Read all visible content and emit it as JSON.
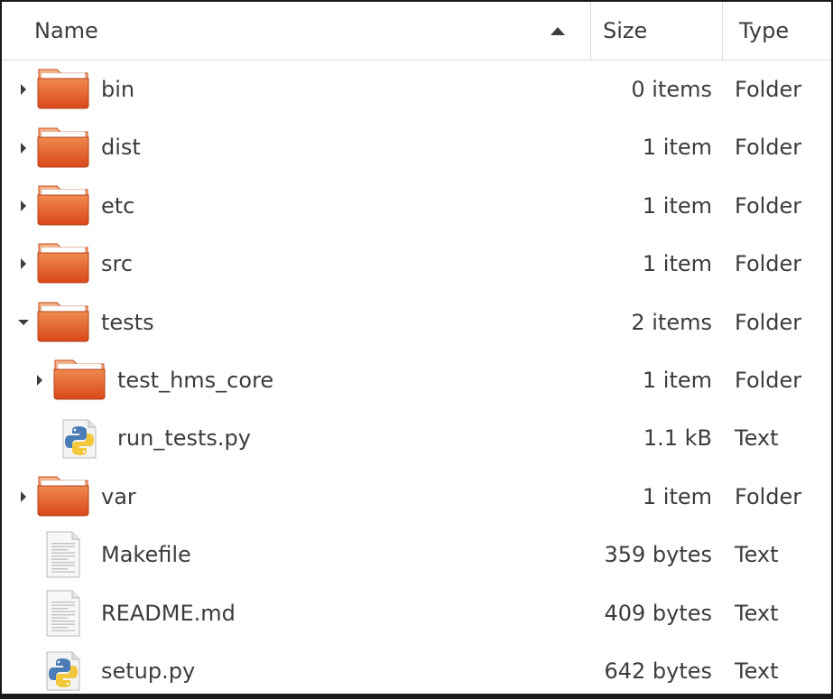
{
  "columns": {
    "name": "Name",
    "size": "Size",
    "type": "Type"
  },
  "colors": {
    "folder_top": "#f7a26f",
    "folder_body": "#e05520",
    "text": "#3c3c3c"
  },
  "rows": [
    {
      "name": "bin",
      "size": "0 items",
      "type": "Folder",
      "icon": "folder-icon",
      "expander": "collapsed",
      "depth": 0
    },
    {
      "name": "dist",
      "size": "1 item",
      "type": "Folder",
      "icon": "folder-icon",
      "expander": "collapsed",
      "depth": 0
    },
    {
      "name": "etc",
      "size": "1 item",
      "type": "Folder",
      "icon": "folder-icon",
      "expander": "collapsed",
      "depth": 0
    },
    {
      "name": "src",
      "size": "1 item",
      "type": "Folder",
      "icon": "folder-icon",
      "expander": "collapsed",
      "depth": 0
    },
    {
      "name": "tests",
      "size": "2 items",
      "type": "Folder",
      "icon": "folder-icon",
      "expander": "expanded",
      "depth": 0
    },
    {
      "name": "test_hms_core",
      "size": "1 item",
      "type": "Folder",
      "icon": "folder-icon",
      "expander": "collapsed",
      "depth": 1
    },
    {
      "name": "run_tests.py",
      "size": "1.1 kB",
      "type": "Text",
      "icon": "python-file-icon",
      "expander": "none",
      "depth": 1
    },
    {
      "name": "var",
      "size": "1 item",
      "type": "Folder",
      "icon": "folder-icon",
      "expander": "collapsed",
      "depth": 0
    },
    {
      "name": "Makefile",
      "size": "359 bytes",
      "type": "Text",
      "icon": "text-file-icon",
      "expander": "none",
      "depth": 0
    },
    {
      "name": "README.md",
      "size": "409 bytes",
      "type": "Text",
      "icon": "text-file-icon",
      "expander": "none",
      "depth": 0
    },
    {
      "name": "setup.py",
      "size": "642 bytes",
      "type": "Text",
      "icon": "python-file-icon",
      "expander": "none",
      "depth": 0
    }
  ]
}
